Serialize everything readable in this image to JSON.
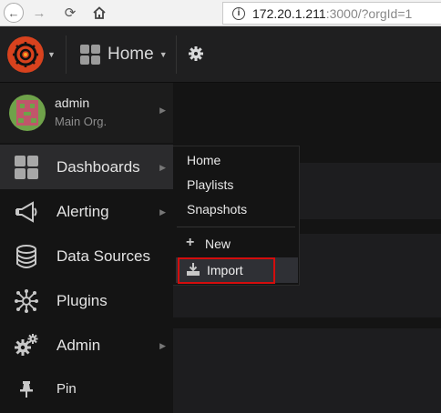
{
  "browser": {
    "url_host": "172.20.1.211",
    "url_rest": ":3000/?orgId=1"
  },
  "topnav": {
    "home_label": "Home"
  },
  "profile": {
    "username": "admin",
    "org": "Main Org."
  },
  "sidemenu": {
    "items": [
      {
        "label": "Dashboards",
        "icon": "dashboards-grid-icon"
      },
      {
        "label": "Alerting",
        "icon": "megaphone-icon"
      },
      {
        "label": "Data Sources",
        "icon": "database-icon"
      },
      {
        "label": "Plugins",
        "icon": "plugins-icon"
      },
      {
        "label": "Admin",
        "icon": "gears-icon"
      },
      {
        "label": "Pin",
        "icon": "pin-icon"
      }
    ]
  },
  "submenu": {
    "items": [
      "Home",
      "Playlists",
      "Snapshots"
    ],
    "new_label": "New",
    "import_label": "Import"
  },
  "colors": {
    "logo": "#d8421e",
    "highlight": "#d40d0d"
  }
}
